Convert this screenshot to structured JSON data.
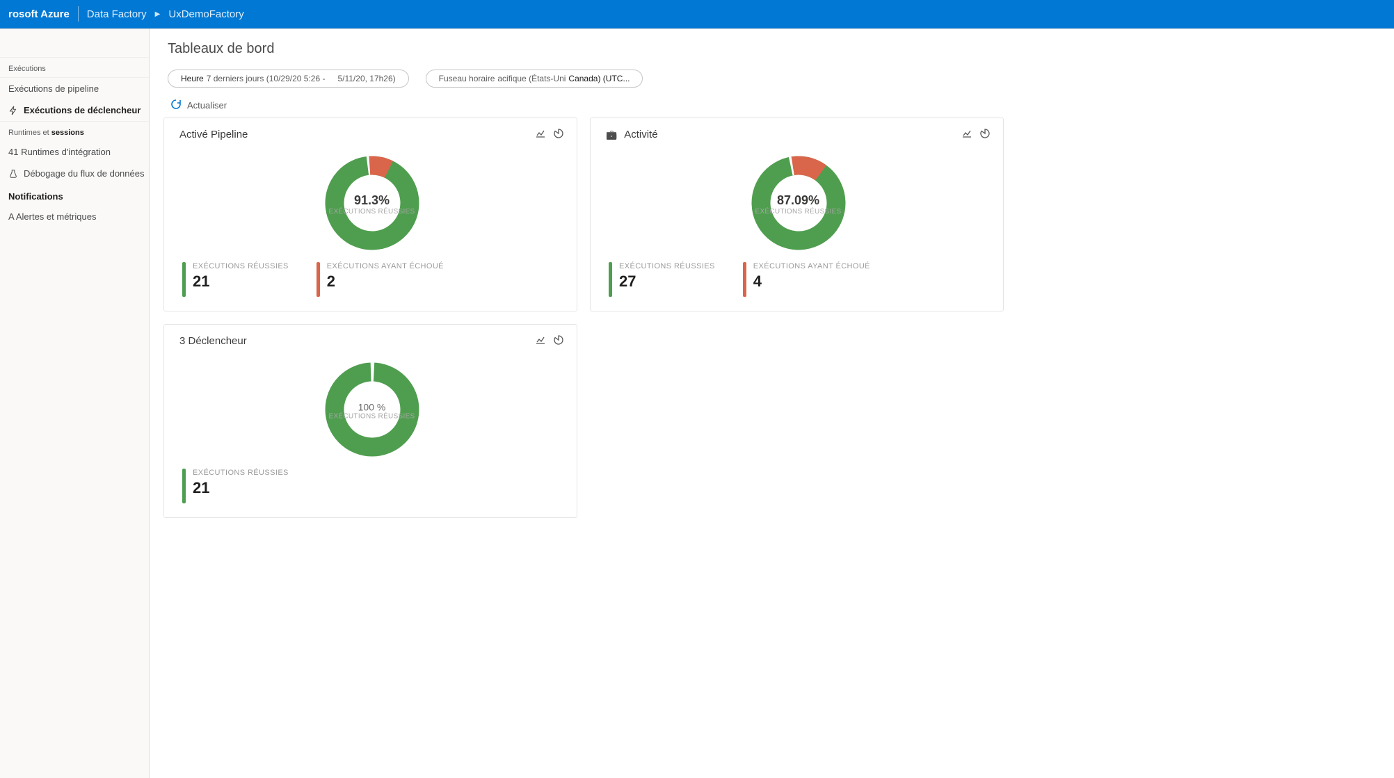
{
  "header": {
    "brand": "rosoft Azure",
    "crumb1": "Data Factory",
    "crumb2": "UxDemoFactory"
  },
  "sidebar": {
    "group_exec": "Exécutions",
    "item_pipeline": "Exécutions de pipeline",
    "item_trigger": "Exécutions de déclencheur",
    "group_runtime_prefix": "Runtimes et",
    "group_runtime_bold": "sessions",
    "item_integration": "41 Runtimes d'intégration",
    "item_debug": "Débogage du flux de données",
    "group_notif": "Notifications",
    "item_alerts": "A Alertes et  métriques"
  },
  "page": {
    "title": "Tableaux de bord",
    "pill_time_label": "Heure",
    "pill_time_range": "7 derniers jours (10/29/20 5:26 -",
    "pill_time_end": "5/11/20, 17h26)",
    "pill_tz_label": "Fuseau horaire",
    "pill_tz_value_a": "acifique (États-Uni",
    "pill_tz_value_b": "Canada) (UTC...",
    "refresh": "Actualiser"
  },
  "cards": {
    "pipeline": {
      "title": "Activé Pipeline",
      "center_pct": "91.3%",
      "center_label": "EXÉCUTIONS RÉUSSIES",
      "succ_label": "EXÉCUTIONS RÉUSSIES",
      "succ_val": "21",
      "fail_label": "EXÉCUTIONS AYANT ÉCHOUÉ",
      "fail_val": "2"
    },
    "activity": {
      "title": "Activité",
      "center_pct": "87.09%",
      "center_label": "EXÉCUTIONS RÉUSSIES",
      "succ_label": "EXÉCUTIONS RÉUSSIES",
      "succ_val": "27",
      "fail_label": "EXÉCUTIONS AYANT ÉCHOUÉ",
      "fail_val": "4"
    },
    "trigger": {
      "title": "3 Déclencheur",
      "center_pct": "100 %",
      "center_label": "EXÉCUTIONS RÉUSSIES",
      "succ_label": "EXÉCUTIONS RÉUSSIES",
      "succ_val": "21"
    }
  },
  "chart_data": [
    {
      "type": "pie",
      "title": "Activé Pipeline",
      "categories": [
        "Exécutions réussies",
        "Exécutions ayant échoué"
      ],
      "values": [
        21,
        2
      ],
      "percent_success": 91.3
    },
    {
      "type": "pie",
      "title": "Activité",
      "categories": [
        "Exécutions réussies",
        "Exécutions ayant échoué"
      ],
      "values": [
        27,
        4
      ],
      "percent_success": 87.09
    },
    {
      "type": "pie",
      "title": "3 Déclencheur",
      "categories": [
        "Exécutions réussies"
      ],
      "values": [
        21
      ],
      "percent_success": 100
    }
  ]
}
